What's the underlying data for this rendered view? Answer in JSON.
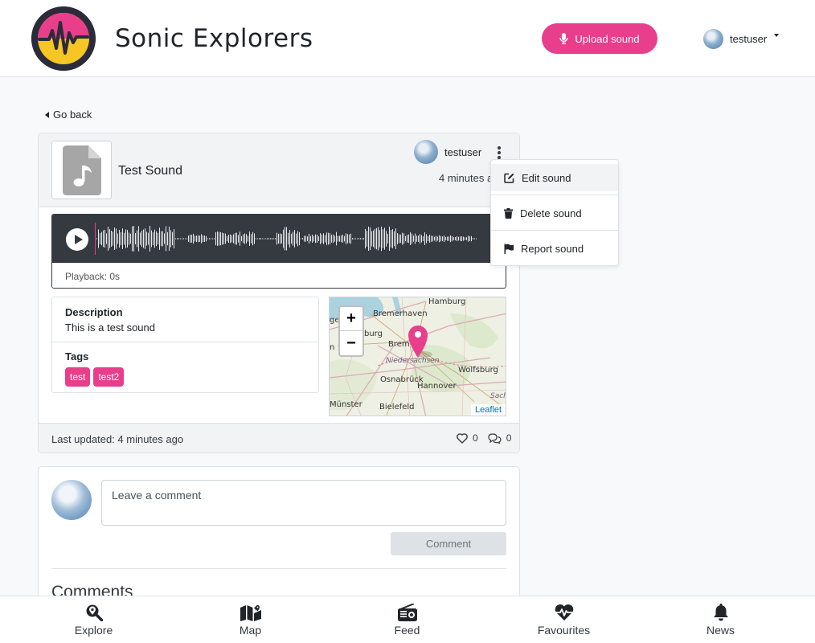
{
  "header": {
    "brand": "Sonic Explorers",
    "upload_label": "Upload sound",
    "username": "testuser",
    "colors": {
      "accent": "#e83e8c",
      "logo_bg": "#2b2b3a",
      "logo_yellow": "#f6c624"
    }
  },
  "nav": {
    "go_back": "Go back"
  },
  "sound": {
    "title": "Test Sound",
    "owner": "testuser",
    "time_ago": "4 minutes ago",
    "playback": "Playback: 0s",
    "description_label": "Description",
    "description": "This is a test sound",
    "tags_label": "Tags",
    "tags": [
      "test",
      "test2"
    ],
    "last_updated": "Last updated: 4 minutes ago",
    "likes": "0",
    "comments_count": "0"
  },
  "map": {
    "zoom_in": "+",
    "zoom_out": "−",
    "attribution": "Leaflet",
    "labels": {
      "hamburg": "Hamburg",
      "bremerhaven": "Bremerhaven",
      "burg": "burg",
      "ge": "ge",
      "n": "n",
      "bremen": "Brem",
      "niedersachsen": "Niedersachsen",
      "wolfsburg": "Wolfsburg",
      "osnabrueck": "Osnabrück",
      "hannover": "Hannover",
      "sach": "Sach",
      "muenster": "Münster",
      "bielefeld": "Bielefeld"
    }
  },
  "menu": {
    "edit": "Edit sound",
    "delete": "Delete sound",
    "report": "Report sound"
  },
  "comments": {
    "placeholder": "Leave a comment",
    "submit": "Comment",
    "heading": "Comments"
  },
  "bottom_nav": [
    {
      "label": "Explore",
      "icon": "search-location-icon"
    },
    {
      "label": "Map",
      "icon": "map-icon"
    },
    {
      "label": "Feed",
      "icon": "radio-icon"
    },
    {
      "label": "Favourites",
      "icon": "heartbeat-icon"
    },
    {
      "label": "News",
      "icon": "bell-icon"
    }
  ]
}
